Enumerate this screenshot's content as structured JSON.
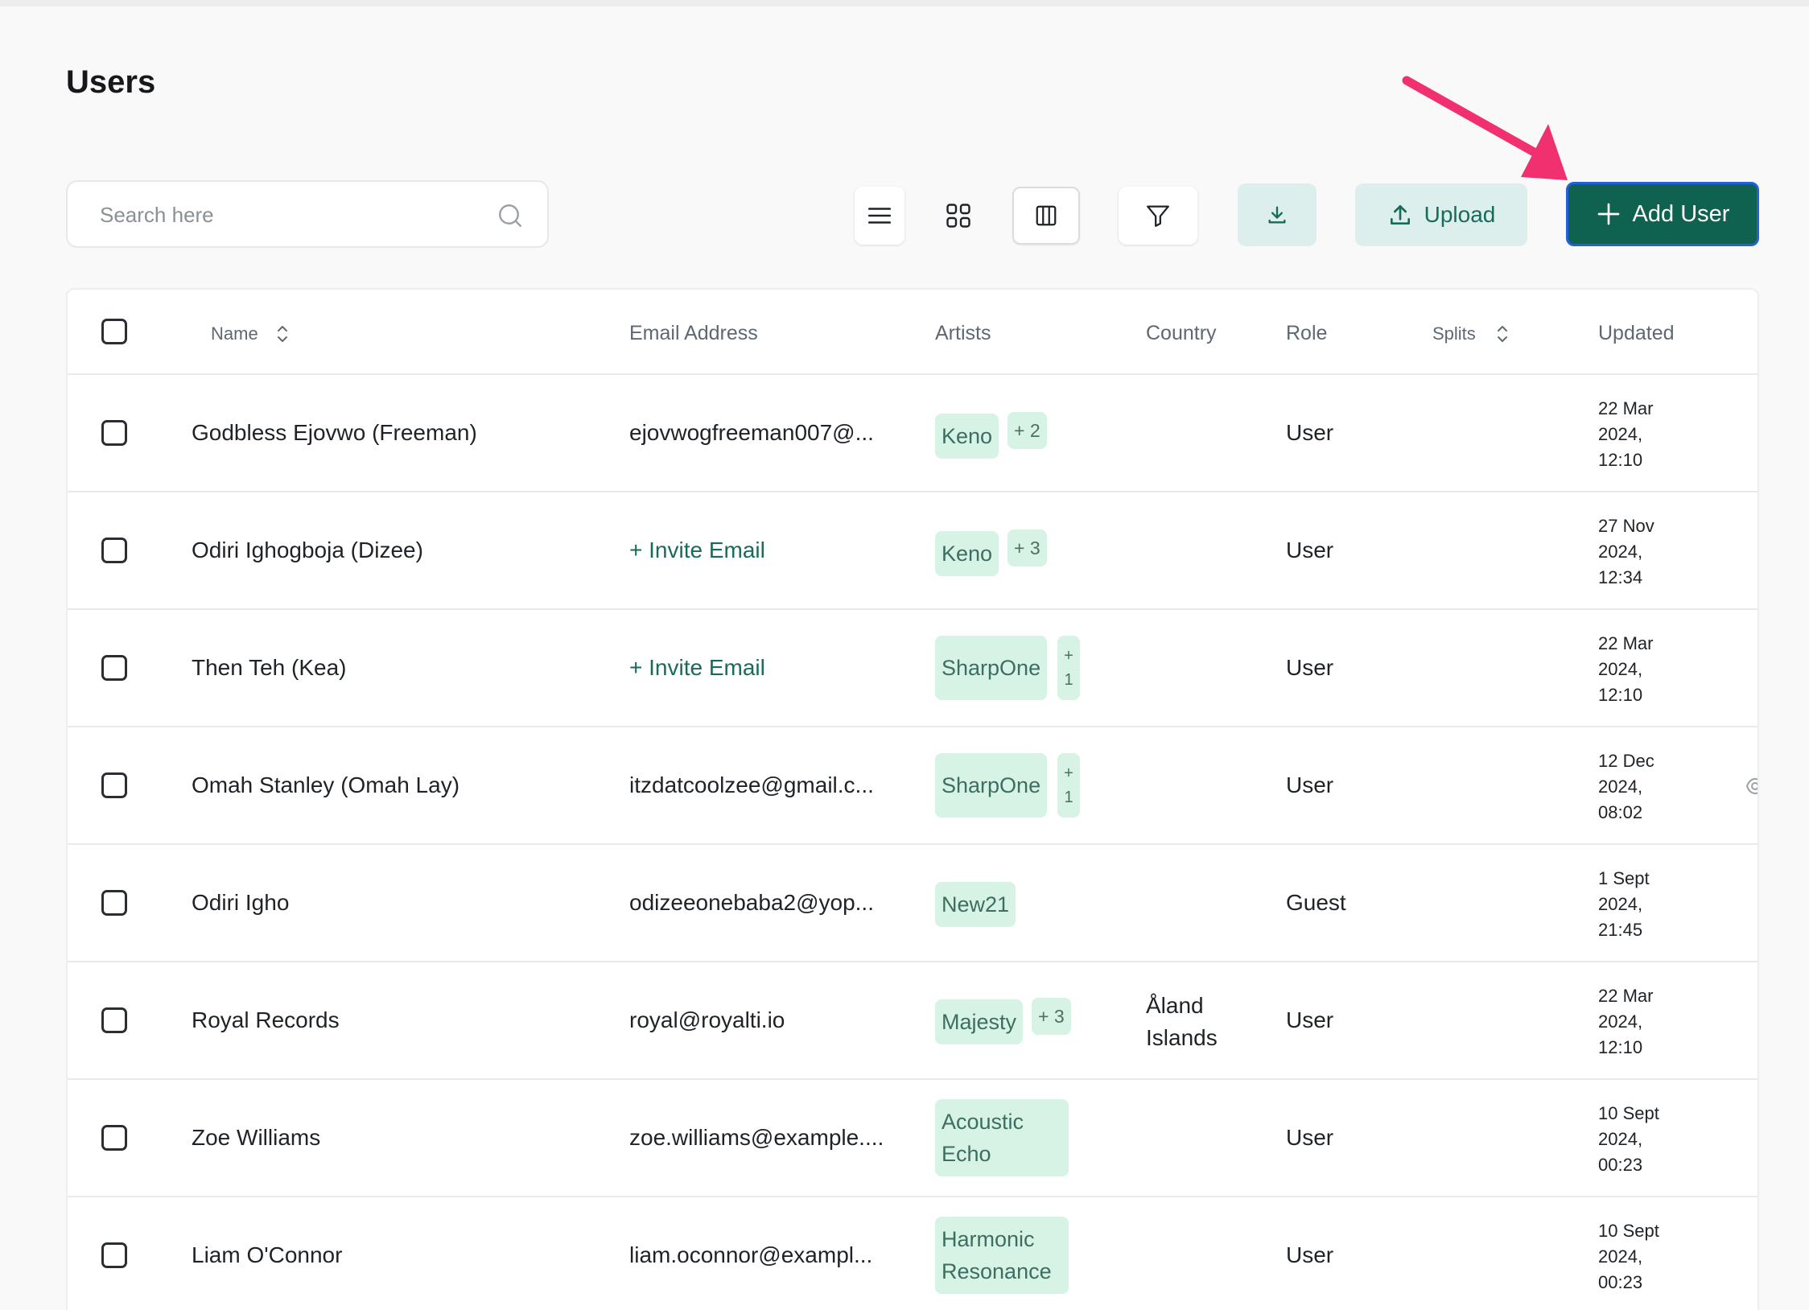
{
  "page": {
    "title": "Users"
  },
  "search": {
    "placeholder": "Search here"
  },
  "toolbar": {
    "upload_label": "Upload",
    "add_user_label": "Add User",
    "icons": [
      "list-view-icon",
      "grid-view-icon",
      "columns-icon",
      "filter-icon",
      "download-icon",
      "upload-icon",
      "plus-icon"
    ]
  },
  "colors": {
    "primary": "#0f6150",
    "primary_border": "#2361d8",
    "mint": "#dcefec",
    "chip": "#d6f3e6",
    "accent_arrow": "#f0306f"
  },
  "table": {
    "headers": {
      "name": "Name",
      "email": "Email Address",
      "artists": "Artists",
      "country": "Country",
      "role": "Role",
      "splits": "Splits",
      "updated": "Updated"
    },
    "rows": [
      {
        "name": "Godbless Ejovwo (Freeman)",
        "email": "ejovwogfreeman007@...",
        "artist": "Keno",
        "more": "+ 2",
        "country": "",
        "role": "User",
        "updated": [
          "22 Mar",
          "2024,",
          "12:10"
        ]
      },
      {
        "name": "Odiri Ighogboja (Dizee)",
        "email": "+ Invite Email",
        "artist": "Keno",
        "more": "+ 3",
        "country": "",
        "role": "User",
        "updated": [
          "27 Nov",
          "2024,",
          "12:34"
        ]
      },
      {
        "name": "Then Teh (Kea)",
        "email": "+ Invite Email",
        "artist": "SharpOne",
        "more": [
          "+",
          "1"
        ],
        "country": "",
        "role": "User",
        "updated": [
          "22 Mar",
          "2024,",
          "12:10"
        ]
      },
      {
        "name": "Omah Stanley (Omah Lay)",
        "email": "itzdatcoolzee@gmail.c...",
        "artist": "SharpOne",
        "more": [
          "+",
          "1"
        ],
        "country": "",
        "role": "User",
        "updated": [
          "12 Dec",
          "2024,",
          "08:02"
        ]
      },
      {
        "name": "Odiri Igho",
        "email": "odizeeonebaba2@yop...",
        "artist": "New21",
        "more": "",
        "country": "",
        "role": "Guest",
        "updated": [
          "1 Sept",
          "2024,",
          "21:45"
        ]
      },
      {
        "name": "Royal Records",
        "email": "royal@royalti.io",
        "artist": "Majesty",
        "more": "+ 3",
        "country": [
          "Åland",
          "Islands"
        ],
        "role": "User",
        "updated": [
          "22 Mar",
          "2024,",
          "12:10"
        ]
      },
      {
        "name": "Zoe Williams",
        "email": "zoe.williams@example....",
        "artist": [
          "Acoustic",
          "Echo"
        ],
        "more": "",
        "country": "",
        "role": "User",
        "updated": [
          "10 Sept",
          "2024,",
          "00:23"
        ]
      },
      {
        "name": "Liam O'Connor",
        "email": "liam.oconnor@exampl...",
        "artist": [
          "Harmonic",
          "Resonance"
        ],
        "more": "",
        "country": "",
        "role": "User",
        "updated": [
          "10 Sept",
          "2024,",
          "00:23"
        ]
      }
    ]
  }
}
